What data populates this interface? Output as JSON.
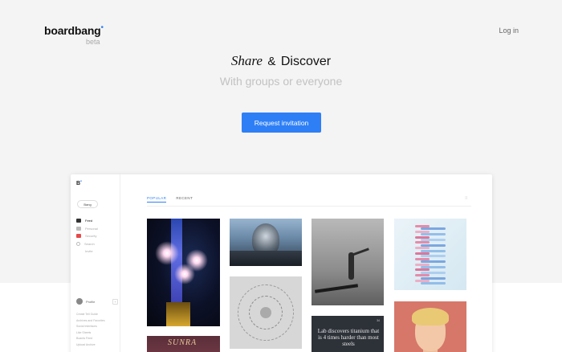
{
  "header": {
    "brand": "boardbang",
    "brand_dot": "•",
    "brand_tag": "beta",
    "login_label": "Log in"
  },
  "hero": {
    "headline_share": "Share",
    "headline_amp": "&",
    "headline_discover": "Discover",
    "subheadline": "With groups or everyone",
    "cta_label": "Request invitation"
  },
  "colors": {
    "accent": "#2e7ff6",
    "hero_bg": "#f4f4f4",
    "subtitle": "#c2c2c2"
  },
  "preview": {
    "logo": "B",
    "logo_dot": "•",
    "pill_label": "Bang",
    "nav": [
      {
        "label": "Feed",
        "icon": "home-icon",
        "active": true
      },
      {
        "label": "Personal",
        "icon": "folder-icon",
        "active": false
      },
      {
        "label": "Security",
        "icon": "bang-icon",
        "active": false
      },
      {
        "label": "Search",
        "icon": "search-icon",
        "active": false
      },
      {
        "label": "Invite",
        "icon": "",
        "active": false
      }
    ],
    "profile_name": "Profile",
    "profile_plus": "+",
    "footer_links": [
      "Create Tell Guide",
      "Archives and Favorites",
      "Social Interfaces",
      "Like Sheets",
      "Boards Feed",
      "Upload Archive"
    ],
    "tabs": [
      {
        "label": "POPULAR",
        "active": true
      },
      {
        "label": "RECENT",
        "active": false
      }
    ],
    "grid_icon": "⁞⁞",
    "card_sunra_title": "SUNRA",
    "card_news_text": "Lab discovers titanium that is 4 times harder than most steels",
    "card_news_tag": "34"
  }
}
